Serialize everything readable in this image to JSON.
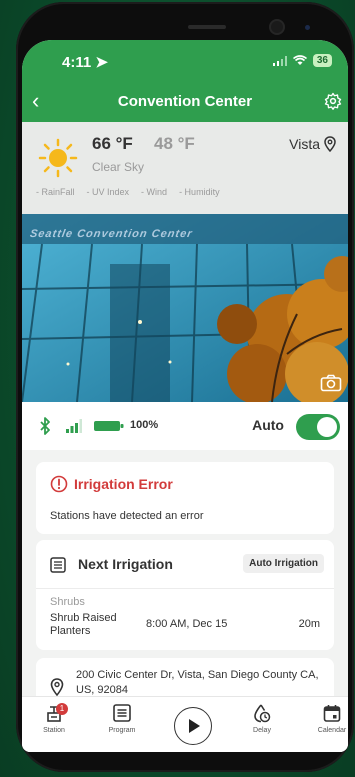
{
  "status_bar": {
    "time": "4:11",
    "battery": "36"
  },
  "header": {
    "title": "Convention Center"
  },
  "weather": {
    "high": "66 °F",
    "low": "48 °F",
    "condition": "Clear Sky",
    "location": "Vista",
    "metrics": [
      "- RainFall",
      "- UV Index",
      "- Wind",
      "- Humidity"
    ]
  },
  "photo": {
    "sign_text": "Seattle Convention Center"
  },
  "controller": {
    "battery": "100%",
    "mode_label": "Auto",
    "auto_enabled": true
  },
  "error_card": {
    "title": "Irrigation Error",
    "message": "Stations have detected an error"
  },
  "next_irrigation": {
    "title": "Next Irrigation",
    "badge": "Auto Irrigation",
    "zone": "Shrubs",
    "station": "Shrub Raised Planters",
    "time": "8:00 AM, Dec 15",
    "duration": "20m"
  },
  "address": {
    "text": "200 Civic Center Dr, Vista, San Diego County CA, US, 92084"
  },
  "tabs": {
    "station": "Station",
    "program": "Program",
    "delay": "Delay",
    "calendar": "Calendar",
    "station_badge": "1"
  },
  "colors": {
    "primary_green": "#2f9e4e",
    "error_red": "#d23b3b"
  }
}
